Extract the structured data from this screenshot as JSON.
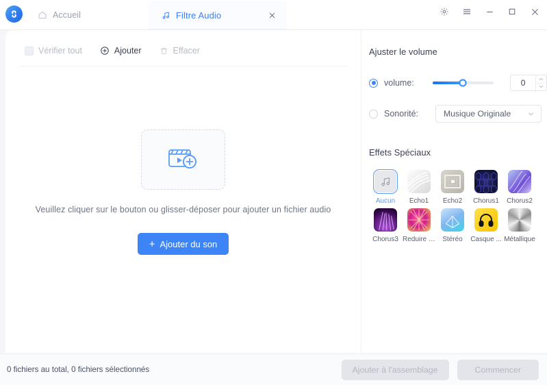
{
  "window": {
    "logo_icon": "app-logo-swirl",
    "controls": [
      {
        "name": "settings-button",
        "icon": "gear-icon"
      },
      {
        "name": "menu-button",
        "icon": "hamburger-icon"
      },
      {
        "name": "minimize-button",
        "icon": "minimize-icon"
      },
      {
        "name": "maximize-button",
        "icon": "maximize-icon"
      },
      {
        "name": "close-button",
        "icon": "close-icon"
      }
    ]
  },
  "tabs": [
    {
      "label": "Accueil",
      "icon": "home-icon",
      "active": false,
      "closable": false
    },
    {
      "label": "Filtre Audio",
      "icon": "music-note-icon",
      "active": true,
      "closable": true
    }
  ],
  "toolbar": {
    "check_all_label": "Vérifier tout",
    "add_label": "Ajouter",
    "clear_label": "Effacer"
  },
  "dropzone": {
    "icon": "clapperboard-add-icon",
    "hint": "Veuillez cliquer sur le bouton ou glisser-déposer pour ajouter un fichier audio",
    "button_label": "Ajouter du son",
    "button_plus": "+"
  },
  "panel": {
    "volume_section_title": "Ajuster le volume",
    "volume_radio_label": "volume:",
    "volume_radio_selected": true,
    "volume_value": "0",
    "slider_percent": 50,
    "sonorite_radio_label": "Sonorité:",
    "sonorite_radio_selected": false,
    "sonorite_value": "Musique Originale",
    "effects_section_title": "Effets Spéciaux",
    "effects": [
      {
        "label": "Aucun",
        "selected": true,
        "style": "none"
      },
      {
        "label": "Écho1",
        "selected": false,
        "style": "echo1"
      },
      {
        "label": "Écho2",
        "selected": false,
        "style": "echo2"
      },
      {
        "label": "Chorus1",
        "selected": false,
        "style": "chorus1"
      },
      {
        "label": "Chorus2",
        "selected": false,
        "style": "chorus2"
      },
      {
        "label": "Chorus3",
        "selected": false,
        "style": "chorus3"
      },
      {
        "label": "Reduire l...",
        "selected": false,
        "style": "reduire"
      },
      {
        "label": "Stéréo",
        "selected": false,
        "style": "stereo"
      },
      {
        "label": "Casque ...",
        "selected": false,
        "style": "casque"
      },
      {
        "label": "Métallique",
        "selected": false,
        "style": "metallique"
      }
    ]
  },
  "footer": {
    "status": "0 fichiers au total, 0 fichiers sélectionnés",
    "add_to_assembly_label": "Ajouter à l'assemblage",
    "start_label": "Commencer"
  },
  "colors": {
    "accent": "#3d85f7",
    "tab_active_text": "#3d7ef5",
    "panel_bg": "#ffffff",
    "app_bg": "#f4f6fa"
  }
}
